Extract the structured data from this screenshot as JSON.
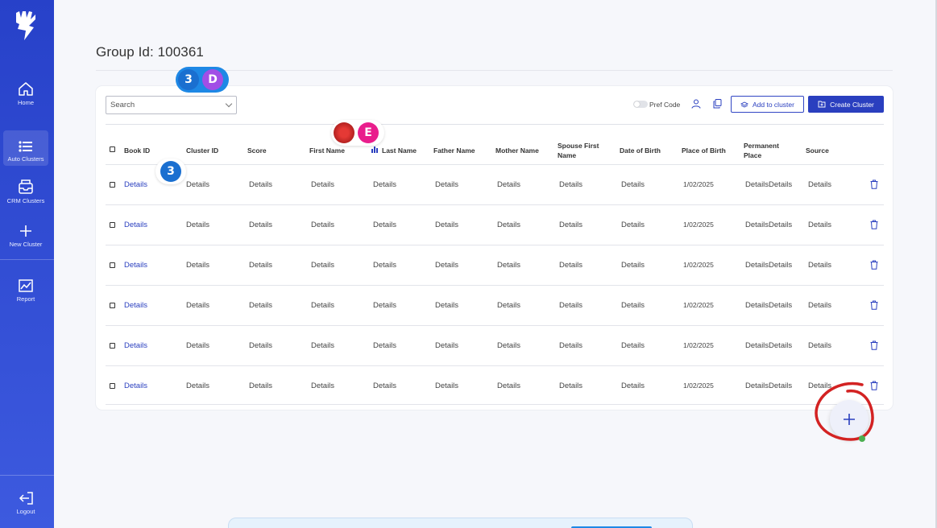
{
  "sidebar": {
    "items": [
      {
        "label": "Home",
        "icon": "home-icon"
      },
      {
        "label": "Auto Clusters",
        "icon": "list-icon"
      },
      {
        "label": "CRM Clusters",
        "icon": "inbox-icon"
      },
      {
        "label": "New Cluster",
        "icon": "plus-icon"
      },
      {
        "label": "Report",
        "icon": "chart-icon"
      }
    ],
    "logout": "Logout"
  },
  "page": {
    "title": "Group Id: 100361"
  },
  "toolbar": {
    "search_placeholder": "Search",
    "pref_code": "Pref Code",
    "add_to_cluster": "Add to cluster",
    "create_cluster": "Create Cluster"
  },
  "table": {
    "columns": [
      "Book ID",
      "Cluster ID",
      "Score",
      "First Name",
      "Last Name",
      "Father Name",
      "Mother Name",
      "Spouse First Name",
      "Date of Birth",
      "Place of Birth",
      "Permanent Place",
      "Source"
    ],
    "rows": [
      [
        "Details",
        "Details",
        "Details",
        "Details",
        "Details",
        "Details",
        "Details",
        "Details",
        "Details",
        "1/02/2025",
        "DetailsDetails",
        "Details"
      ],
      [
        "Details",
        "Details",
        "Details",
        "Details",
        "Details",
        "Details",
        "Details",
        "Details",
        "Details",
        "1/02/2025",
        "DetailsDetails",
        "Details"
      ],
      [
        "Details",
        "Details",
        "Details",
        "Details",
        "Details",
        "Details",
        "Details",
        "Details",
        "Details",
        "1/02/2025",
        "DetailsDetails",
        "Details"
      ],
      [
        "Details",
        "Details",
        "Details",
        "Details",
        "Details",
        "Details",
        "Details",
        "Details",
        "Details",
        "1/02/2025",
        "DetailsDetails",
        "Details"
      ],
      [
        "Details",
        "Details",
        "Details",
        "Details",
        "Details",
        "Details",
        "Details",
        "Details",
        "Details",
        "1/02/2025",
        "DetailsDetails",
        "Details"
      ],
      [
        "Details",
        "Details",
        "Details",
        "Details",
        "Details",
        "Details",
        "Details",
        "Details",
        "Details",
        "1/02/2025",
        "DetailsDetails",
        "Details"
      ]
    ]
  },
  "collaborators": {
    "group1": {
      "count": "3",
      "initial": "D"
    },
    "group2": {
      "initial": "E"
    },
    "badge": "3"
  },
  "colors": {
    "sidebar": "#2741c9",
    "accent": "#2a3fbf",
    "annotation": "#d32222"
  }
}
